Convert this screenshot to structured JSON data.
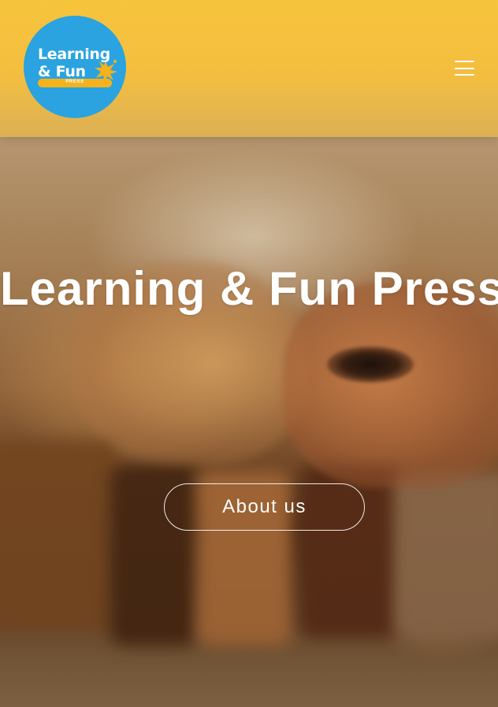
{
  "site": {
    "logo": {
      "line1": "Learning",
      "line2": "& Fun",
      "tagline": "PRESS",
      "icon": "paint-splash-icon"
    },
    "menu_icon": "hamburger-menu-icon"
  },
  "hero": {
    "title": "Learning & Fun Press",
    "cta_label": "About us"
  },
  "colors": {
    "header_yellow": "#f7c43c",
    "logo_blue": "#2aa3e0",
    "logo_accent": "#f6b21b",
    "text_white": "#ffffff"
  }
}
